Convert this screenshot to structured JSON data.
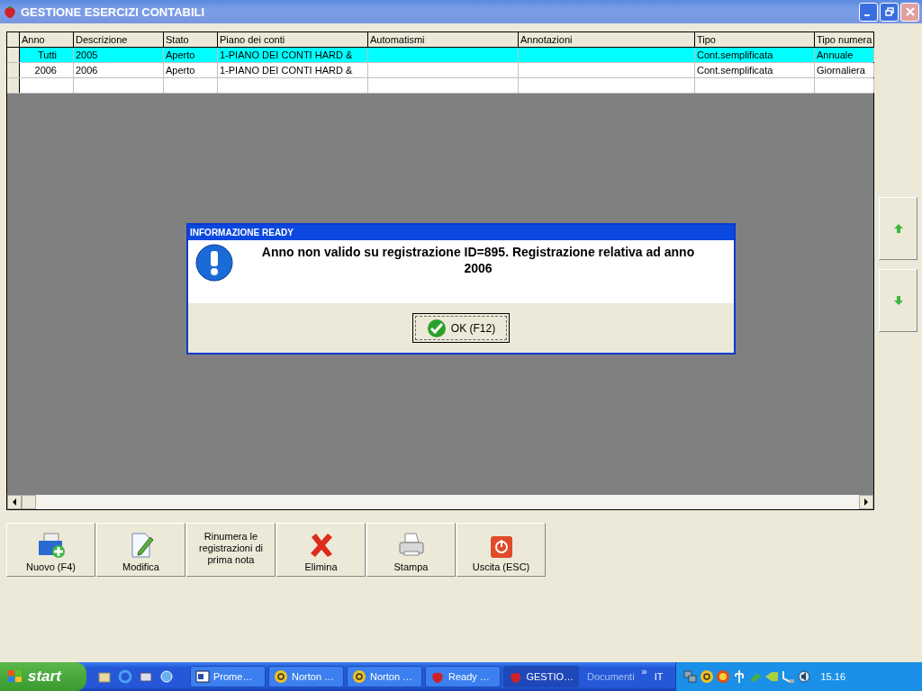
{
  "window": {
    "title": "GESTIONE ESERCIZI CONTABILI"
  },
  "table": {
    "columns": [
      "Anno",
      "Descrizione",
      "Stato",
      "Piano dei conti",
      "Automatismi",
      "Annotazioni",
      "Tipo",
      "Tipo numera"
    ],
    "rows": [
      {
        "selected": true,
        "cells": [
          "Tutti",
          "2005",
          "Aperto",
          "1-PIANO DEI CONTI HARD &",
          "",
          "",
          "Cont.semplificata",
          "Annuale"
        ]
      },
      {
        "selected": false,
        "cells": [
          "2006",
          "2006",
          "Aperto",
          "1-PIANO DEI CONTI HARD &",
          "",
          "",
          "Cont.semplificata",
          "Giornaliera"
        ]
      }
    ]
  },
  "toolbar": [
    {
      "kind": "new",
      "label": "Nuovo (F4)"
    },
    {
      "kind": "edit",
      "label": "Modifica"
    },
    {
      "kind": "text",
      "label": "Rinumera le registrazioni di prima nota"
    },
    {
      "kind": "delete",
      "label": "Elimina"
    },
    {
      "kind": "print",
      "label": "Stampa"
    },
    {
      "kind": "exit",
      "label": "Uscita (ESC)"
    }
  ],
  "dialog": {
    "title": "INFORMAZIONE READY",
    "message": "Anno non valido su registrazione ID=895. Registrazione relativa ad anno 2006",
    "button": "OK (F12)"
  },
  "taskbar": {
    "start": "start",
    "tasks": [
      {
        "kind": "word",
        "label": "Prome…",
        "selected": false
      },
      {
        "kind": "norton",
        "label": "Norton …",
        "selected": false
      },
      {
        "kind": "norton",
        "label": "Norton …",
        "selected": false
      },
      {
        "kind": "app",
        "label": "Ready …",
        "selected": false
      },
      {
        "kind": "app",
        "label": "GESTIO…",
        "selected": true
      }
    ],
    "toolbar_label": "Documenti",
    "chevron": "»",
    "language": "IT",
    "clock": "15.16"
  }
}
